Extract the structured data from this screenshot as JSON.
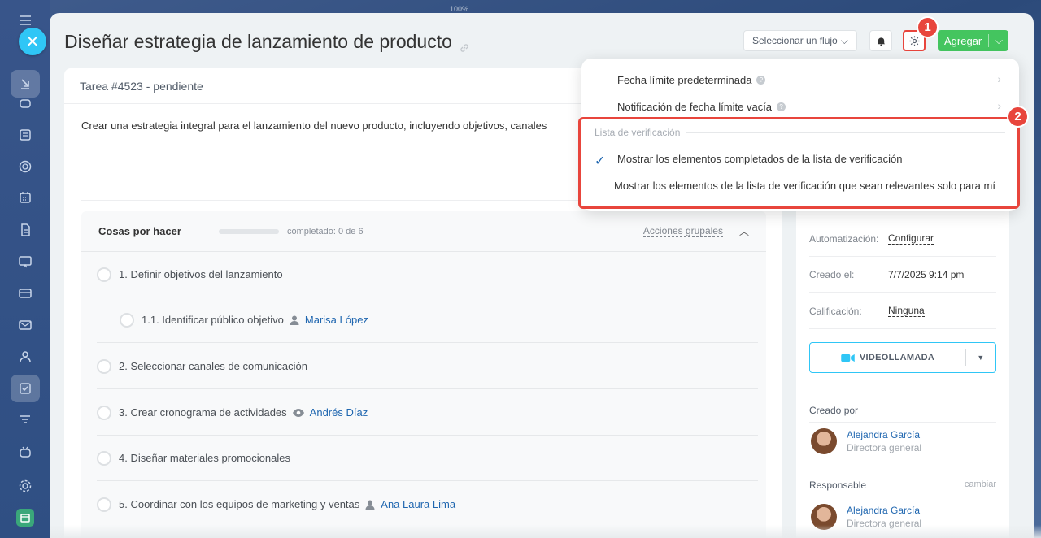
{
  "window": {
    "zoom": "100%"
  },
  "task": {
    "title": "Diseñar estrategia de lanzamiento de producto",
    "header": "Tarea #4523 - pendiente",
    "description": "Crear una estrategia integral para el lanzamiento del nuevo producto, incluyendo objetivos, canales"
  },
  "toolbar": {
    "flow_select": "Seleccionar un flujo",
    "add_label": "Agregar"
  },
  "annotations": {
    "badge1": "1",
    "badge2": "2"
  },
  "checklist": {
    "title": "Cosas por hacer",
    "progress_text": "completado: 0 de 6",
    "progress_fraction": 0,
    "group_actions": "Acciones grupales",
    "items": [
      {
        "text": "1. Definir objetivos del lanzamiento",
        "person": ""
      },
      {
        "text": "1.1. Identificar público objetivo",
        "person": "Marisa López",
        "person_icon": "user-icon"
      },
      {
        "text": "2. Seleccionar canales de comunicación",
        "person": ""
      },
      {
        "text": "3. Crear cronograma de actividades",
        "person": "Andrés Díaz",
        "person_icon": "eye-icon"
      },
      {
        "text": "4. Diseñar materiales promocionales",
        "person": ""
      },
      {
        "text": "5. Coordinar con los equipos de marketing y ventas",
        "person": "Ana Laura Lima",
        "person_icon": "user-icon"
      }
    ]
  },
  "sidebar": {
    "automation_label": "Automatización:",
    "automation_value": "Configurar",
    "created_label": "Creado el:",
    "created_value": "7/7/2025 9:14 pm",
    "rating_label": "Calificación:",
    "rating_value": "Ninguna",
    "video_button": "VIDEOLLAMADA",
    "created_by_label": "Creado por",
    "creator": {
      "name": "Alejandra García",
      "role": "Directora general"
    },
    "responsible_label": "Responsable",
    "change_label": "cambiar",
    "responsible": {
      "name": "Alejandra García",
      "role": "Directora general"
    }
  },
  "settings_menu": {
    "default_deadline": "Fecha límite predeterminada",
    "empty_deadline_notice": "Notificación de fecha límite vacía",
    "section_checklist": "Lista de verificación",
    "show_completed": "Mostrar los elementos completados de la lista de verificación",
    "show_relevant": "Mostrar los elementos de la lista de verificación que sean relevantes solo para mí"
  },
  "colors": {
    "accent_red": "#e8453c",
    "add_green": "#44c55f",
    "link_blue": "#2067b0",
    "rail_blue": "#2f4f83"
  }
}
